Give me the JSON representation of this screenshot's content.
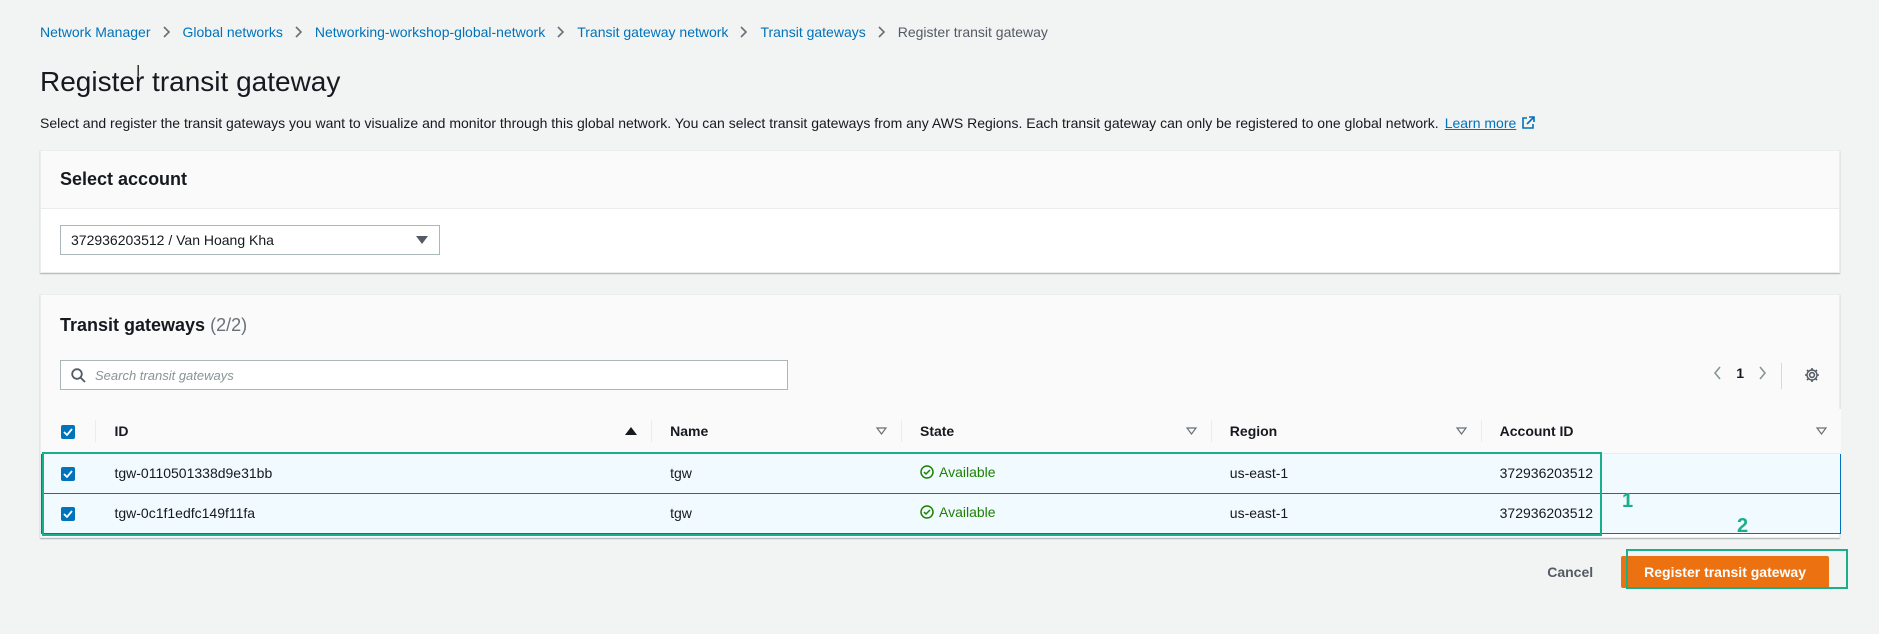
{
  "breadcrumb": [
    {
      "label": "Network Manager"
    },
    {
      "label": "Global networks"
    },
    {
      "label": "Networking-workshop-global-network"
    },
    {
      "label": "Transit gateway network"
    },
    {
      "label": "Transit gateways"
    }
  ],
  "breadcrumb_current": "Register transit gateway",
  "page": {
    "title": "Register transit gateway",
    "description": "Select and register the transit gateways you want to visualize and monitor through this global network. You can select transit gateways from any AWS Regions. Each transit gateway can only be registered to one global network.",
    "learn_more": "Learn more"
  },
  "account_panel": {
    "title": "Select account",
    "selected_account": "372936203512 / Van Hoang Kha"
  },
  "tgw_panel": {
    "title": "Transit gateways",
    "count": "(2/2)",
    "search_placeholder": "Search transit gateways",
    "current_page": "1",
    "columns": [
      "ID",
      "Name",
      "State",
      "Region",
      "Account ID"
    ],
    "rows": [
      {
        "id": "tgw-0110501338d9e31bb",
        "name": "tgw",
        "state": "Available",
        "region": "us-east-1",
        "account": "372936203512",
        "selected": true
      },
      {
        "id": "tgw-0c1f1edfc149f11fa",
        "name": "tgw",
        "state": "Available",
        "region": "us-east-1",
        "account": "372936203512",
        "selected": true
      }
    ]
  },
  "actions": {
    "cancel": "Cancel",
    "register": "Register transit gateway"
  },
  "annotations": {
    "one": "1",
    "two": "2"
  },
  "colors": {
    "link": "#0073bb",
    "primary": "#ec7211",
    "success": "#1d8102",
    "annotation": "#1aaf8b"
  },
  "icons": [
    "chevron-right-icon",
    "external-link-icon",
    "caret-down-icon",
    "search-icon",
    "chevron-left-icon",
    "gear-icon",
    "sort-ascending-icon",
    "sort-icon",
    "check-circle-icon",
    "checkbox-checked-icon"
  ]
}
